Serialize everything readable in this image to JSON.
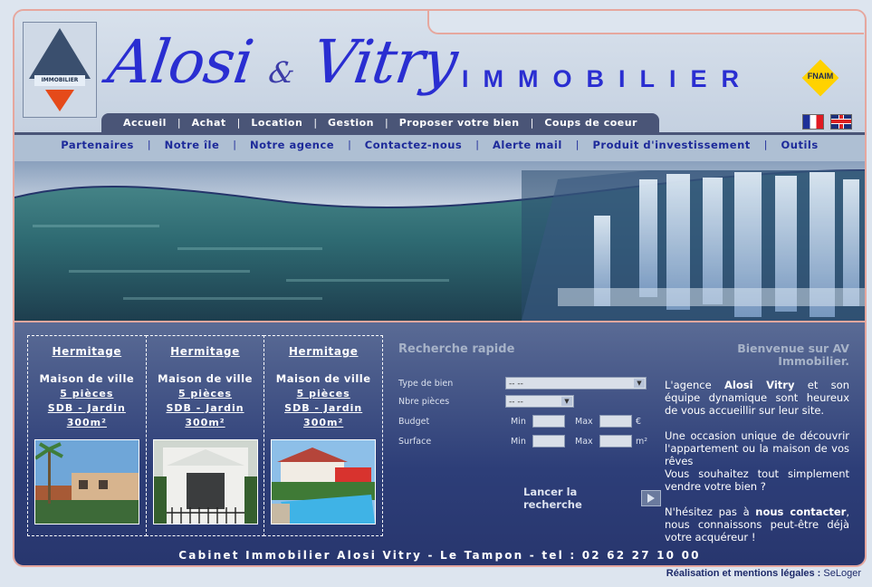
{
  "brand": {
    "name_part1": "Alosi",
    "amp": "&",
    "name_part2": "Vitry",
    "tagline": "IMMOBILIER",
    "logo_text": "IMMOBILIER",
    "fnaim": "FNAIM"
  },
  "topnav": [
    "Accueil",
    "Achat",
    "Location",
    "Gestion",
    "Proposer votre bien",
    "Coups de coeur"
  ],
  "subnav": [
    "Partenaires",
    "Notre île",
    "Notre agence",
    "Contactez-nous",
    "Alerte mail",
    "Produit d'investissement",
    "Outils"
  ],
  "cards": [
    {
      "city": "Hermitage",
      "type": "Maison de ville",
      "rooms": "5 pièces",
      "features": "SDB - Jardin",
      "area": "300m²"
    },
    {
      "city": "Hermitage",
      "type": "Maison de ville",
      "rooms": "5 pièces",
      "features": "SDB - Jardin",
      "area": "300m²"
    },
    {
      "city": "Hermitage",
      "type": "Maison de ville",
      "rooms": "5 pièces",
      "features": "SDB - Jardin",
      "area": "300m²"
    }
  ],
  "search": {
    "title": "Recherche rapide",
    "type_label": "Type de bien",
    "type_value": "-- --",
    "rooms_label": "Nbre pièces",
    "rooms_value": "-- --",
    "budget_label": "Budget",
    "min": "Min",
    "max": "Max",
    "euro": "€",
    "surface_label": "Surface",
    "m2": "m²",
    "submit": "Lancer la recherche"
  },
  "welcome": {
    "title": "Bienvenue sur AV Immobilier.",
    "p1_a": "L'agence ",
    "p1_b": "Alosi Vitry",
    "p1_c": " et son équipe dynamique sont heureux de vous accueillir sur leur site.",
    "p2": "Une occasion unique de découvrir l'appartement ou la maison de vos rêves",
    "p3": "Vous souhaitez tout simplement vendre votre bien ?",
    "p4_a": "N'hésitez pas à ",
    "p4_b": "nous contacter",
    ",p4_c": "",
    "p4_c": ", nous connaissons peut-être déjà votre acquéreur !"
  },
  "footer": "Cabinet Immobilier Alosi Vitry - Le Tampon - tel : 02 62 27 10 00",
  "credit": {
    "label": "Réalisation et mentions légales :",
    "link": "SeLoger"
  },
  "colors": {
    "brand_blue": "#2a2ed1",
    "nav_dark": "#4a5577",
    "frame_border": "#e6a79e"
  }
}
